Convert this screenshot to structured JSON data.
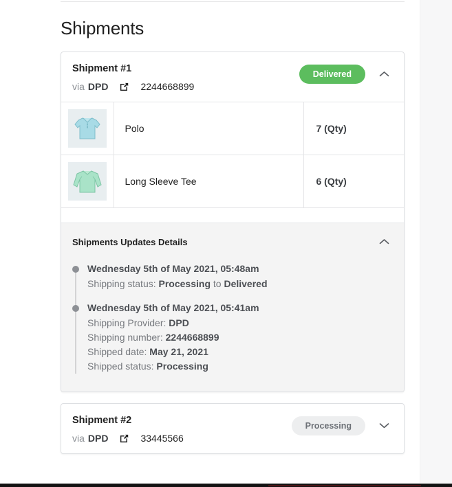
{
  "page": {
    "title": "Shipments"
  },
  "icons": {
    "external_link": "external-link-icon",
    "chevron_up": "chevron-up-icon",
    "chevron_down": "chevron-down-icon"
  },
  "colors": {
    "delivered_badge_bg": "#5cbd5e",
    "delivered_badge_text": "#ffffff",
    "processing_badge_bg": "#edeeef",
    "processing_badge_text": "#6d7177",
    "panel_bg": "#f4f4f4",
    "card_border": "#dddfe2"
  },
  "shipments": [
    {
      "title": "Shipment #1",
      "via_label": "via",
      "carrier": "DPD",
      "tracking_number": "2244668899",
      "status": "Delivered",
      "expanded": true,
      "items": [
        {
          "name": "Polo",
          "qty": "7 (Qty)",
          "thumb": "polo-shirt-thumbnail"
        },
        {
          "name": "Long Sleeve Tee",
          "qty": "6 (Qty)",
          "thumb": "long-sleeve-tee-thumbnail"
        }
      ],
      "updates": {
        "title": "Shipments Updates Details",
        "entries": [
          {
            "date": "Wednesday 5th of May 2021, 05:48am",
            "lines": [
              {
                "label": "Shipping status:",
                "value": "Processing",
                "mid": " to ",
                "value2": "Delivered"
              }
            ]
          },
          {
            "date": "Wednesday 5th of May 2021, 05:41am",
            "lines": [
              {
                "label": "Shipping Provider:",
                "value": "DPD"
              },
              {
                "label": "Shipping number:",
                "value": "2244668899"
              },
              {
                "label": "Shipped date:",
                "value": "May 21, 2021"
              },
              {
                "label": "Shipped status:",
                "value": "Processing"
              }
            ]
          }
        ]
      }
    },
    {
      "title": "Shipment #2",
      "via_label": "via",
      "carrier": "DPD",
      "tracking_number": "33445566",
      "status": "Processing",
      "expanded": false,
      "items": [],
      "updates": null
    }
  ]
}
